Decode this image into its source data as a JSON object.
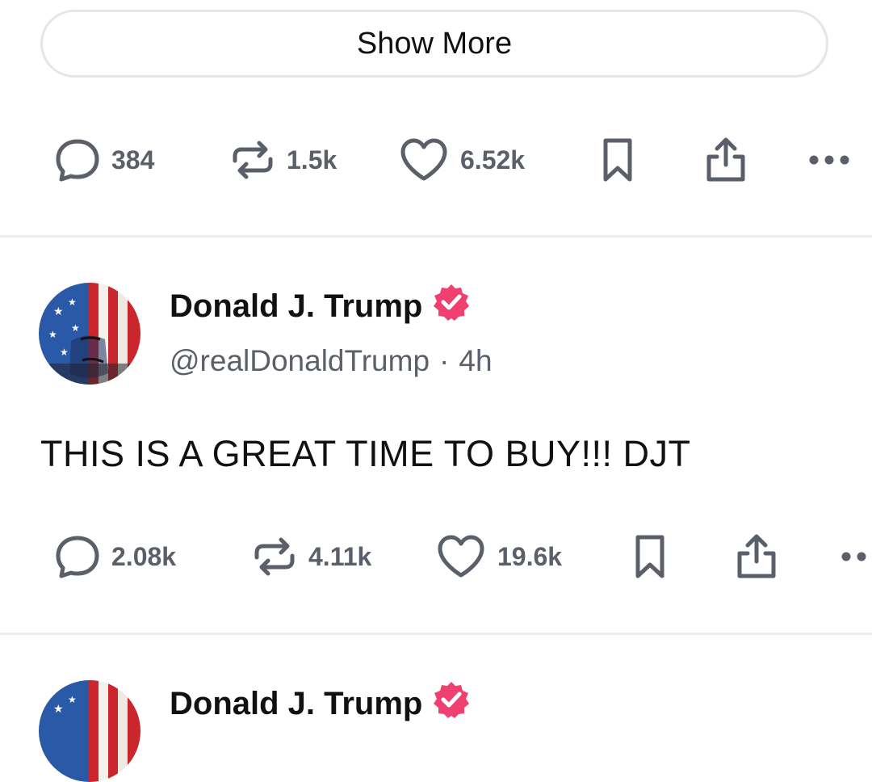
{
  "show_more": {
    "label": "Show More"
  },
  "posts": [
    {
      "actions": {
        "replies": "384",
        "retruths": "1.5k",
        "likes": "6.52k"
      }
    },
    {
      "author": {
        "name": "Donald J. Trump",
        "handle": "@realDonaldTrump",
        "separator": "·",
        "time": "4h"
      },
      "text": "THIS IS A GREAT TIME TO BUY!!! DJT",
      "actions": {
        "replies": "2.08k",
        "retruths": "4.11k",
        "likes": "19.6k"
      }
    },
    {
      "author": {
        "name": "Donald J. Trump"
      }
    }
  ],
  "icons": {
    "reply": "speech-bubble-icon",
    "retruth": "repost-arrows-icon",
    "like": "heart-icon",
    "bookmark": "bookmark-icon",
    "share": "share-upload-icon",
    "more": "more-dots-icon",
    "verified": "verified-badge-icon"
  },
  "colors": {
    "icon_gray": "#5b5f6a",
    "verified": "#f0406f",
    "divider": "#ececee"
  }
}
